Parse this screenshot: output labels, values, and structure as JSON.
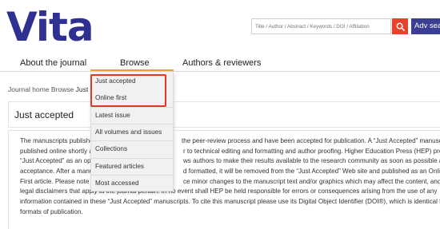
{
  "header": {
    "logo": "Vita",
    "search": {
      "placeholder": "Title / Author / Abstract / Keywords / DOI / Affiliation",
      "value": ""
    },
    "adv_search_label": "Adv sear",
    "accent_color": "#e8412c",
    "brand_color": "#2e3192"
  },
  "nav": {
    "items": [
      {
        "label": "About the journal"
      },
      {
        "label": "Browse"
      },
      {
        "label": "Authors & reviewers"
      }
    ]
  },
  "browse_menu": {
    "items": [
      {
        "label": "Just accepted"
      },
      {
        "label": "Online first"
      },
      {
        "label": "Latest issue"
      },
      {
        "label": "All volumes and issues"
      },
      {
        "label": "Collections"
      },
      {
        "label": "Featured articles"
      },
      {
        "label": "Most accessed"
      }
    ]
  },
  "breadcrumb": {
    "home": "Journal home",
    "browse": "Browse",
    "current": "Just acc"
  },
  "page": {
    "title": "Just accepted",
    "paragraph_lines": [
      "The manuscripts publishe",
      "published online shortly aft",
      "“Just Accepted” as an optic",
      "acceptance. After a manus",
      "First article. Please note th",
      "legal disclaimers that apply to the journal pertain. In no event shall HEP be held responsible for errors or consequences arising from the use of any",
      "information contained in these “Just Accepted” manuscripts. To cite this manuscript please use its Digital Object Identifier (DOI®), which is identical for all",
      "formats of publication."
    ],
    "paragraph_tails": [
      "the peer-review process and have been accepted for publication. A “Just Accepted” manuscript is",
      "r to technical editing and formatting and author proofing. Higher Education Press (HEP) provides",
      "ws authors to make their results available to the research community as soon as possible after",
      "d formatted, it will be removed from the “Just Accepted” Web site and published as an Online",
      "ce minor changes to the manuscript text and/or graphics which may affect the content, and all"
    ]
  }
}
